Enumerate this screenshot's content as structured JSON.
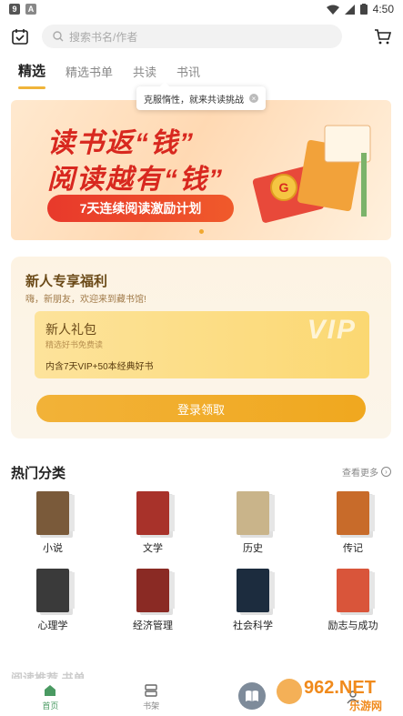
{
  "status_bar": {
    "icon_a": "9",
    "icon_b": "A",
    "time": "4:50"
  },
  "header": {
    "search_placeholder": "搜索书名/作者"
  },
  "tabs": [
    {
      "label": "精选",
      "active": true
    },
    {
      "label": "精选书单",
      "active": false
    },
    {
      "label": "共读",
      "active": false
    },
    {
      "label": "书讯",
      "active": false
    }
  ],
  "tooltip": {
    "text": "克服惰性，就来共读挑战"
  },
  "banner": {
    "line1": "读书返“钱”",
    "line2": "阅读越有“钱”",
    "pill": "7天连续阅读激励计划",
    "coin": "G"
  },
  "newbie": {
    "title": "新人专享福利",
    "subtitle": "嗨，新朋友，欢迎来到藏书馆!",
    "gift_title": "新人礼包",
    "gift_subtitle": "精选好书免费读",
    "gift_detail": "内含7天VIP+50本经典好书",
    "vip": "VIP",
    "login_button": "登录领取"
  },
  "categories_section": {
    "title": "热门分类",
    "more": "查看更多"
  },
  "categories": [
    {
      "label": "小说",
      "color": "#7a5a3a"
    },
    {
      "label": "文学",
      "color": "#a8322a"
    },
    {
      "label": "历史",
      "color": "#c9b48a"
    },
    {
      "label": "传记",
      "color": "#c86b2a"
    },
    {
      "label": "心理学",
      "color": "#3a3a3a"
    },
    {
      "label": "经济管理",
      "color": "#8a2a24"
    },
    {
      "label": "社会科学",
      "color": "#1c2c3e"
    },
    {
      "label": "励志与成功",
      "color": "#d9553a"
    }
  ],
  "peek_section": {
    "title": "阅读推荐 书单"
  },
  "bottom_nav": [
    {
      "label": "首页",
      "active": true
    },
    {
      "label": "书架",
      "active": false
    },
    {
      "label": "",
      "active": false
    },
    {
      "label": "",
      "active": false
    }
  ],
  "watermark": {
    "text": "962.NET",
    "subtext": "乐游网"
  }
}
